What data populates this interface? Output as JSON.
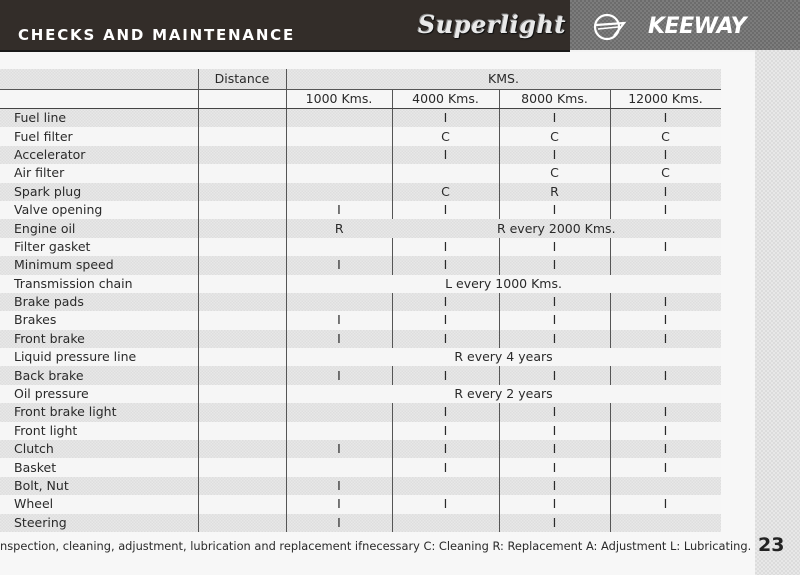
{
  "header": {
    "title": "CHECKS AND MAINTENANCE",
    "model": "Superlight",
    "brand": "KEEWAY",
    "brand_logo_icon": "keeway-logo-icon"
  },
  "table": {
    "distance_label": "Distance",
    "group_label": "KMS.",
    "columns": [
      "1000 Kms.",
      "4000 Kms.",
      "8000 Kms.",
      "12000 Kms."
    ],
    "rows": [
      {
        "item": "Fuel line",
        "values": [
          "",
          "I",
          "I",
          "I"
        ]
      },
      {
        "item": "Fuel filter",
        "values": [
          "",
          "C",
          "C",
          "C"
        ]
      },
      {
        "item": "Accelerator",
        "values": [
          "",
          "I",
          "I",
          "I"
        ]
      },
      {
        "item": "Air filter",
        "values": [
          "",
          "",
          "C",
          "C"
        ]
      },
      {
        "item": "Spark plug",
        "values": [
          "",
          "C",
          "R",
          "I"
        ]
      },
      {
        "item": "Valve opening",
        "values": [
          "I",
          "I",
          "I",
          "I"
        ]
      },
      {
        "item": "Engine oil",
        "values": [
          "R"
        ],
        "span": "R every 2000 Kms."
      },
      {
        "item": "Filter gasket",
        "values": [
          "",
          "I",
          "I",
          "I"
        ]
      },
      {
        "item": "Minimum speed",
        "values": [
          "I",
          "I",
          "I",
          ""
        ]
      },
      {
        "item": "Transmission chain",
        "span_all": "L every 1000 Kms."
      },
      {
        "item": "Brake pads",
        "values": [
          "",
          "I",
          "I",
          "I"
        ]
      },
      {
        "item": "Brakes",
        "values": [
          "I",
          "I",
          "I",
          "I"
        ]
      },
      {
        "item": "Front brake",
        "values": [
          "I",
          "I",
          "I",
          "I"
        ]
      },
      {
        "item": "Liquid pressure line",
        "span_all": "R every 4 years"
      },
      {
        "item": "Back brake",
        "values": [
          "I",
          "I",
          "I",
          "I"
        ]
      },
      {
        "item": "Oil pressure",
        "span_all": "R every 2 years"
      },
      {
        "item": "Front brake light",
        "values": [
          "",
          "I",
          "I",
          "I"
        ]
      },
      {
        "item": "Front light",
        "values": [
          "",
          "I",
          "I",
          "I"
        ]
      },
      {
        "item": "Clutch",
        "values": [
          "I",
          "I",
          "I",
          "I"
        ]
      },
      {
        "item": "Basket",
        "values": [
          "",
          "I",
          "I",
          "I"
        ]
      },
      {
        "item": "Bolt, Nut",
        "values": [
          "I",
          "",
          "I",
          ""
        ]
      },
      {
        "item": "Wheel",
        "values": [
          "I",
          "I",
          "I",
          "I"
        ]
      },
      {
        "item": "Steering",
        "values": [
          "I",
          "",
          "I",
          ""
        ]
      }
    ]
  },
  "footer": {
    "legend": "nspection, cleaning, adjustment, lubrication and replacement ifnecessary  C: Cleaning   R: Replacement  A: Adjustment  L: Lubricating.",
    "page_number": "23"
  }
}
